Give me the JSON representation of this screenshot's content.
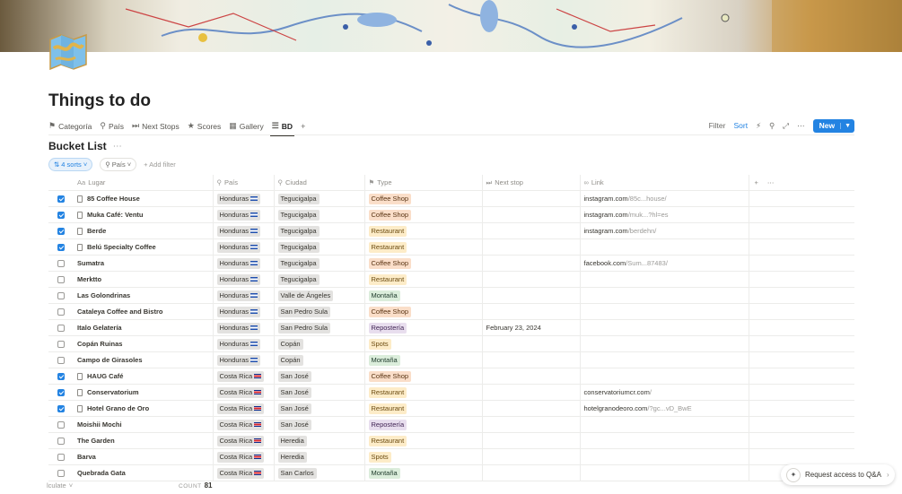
{
  "page": {
    "title": "Things to do"
  },
  "tabs": [
    {
      "label": "Categoría",
      "icon": "tag-icon"
    },
    {
      "label": "País",
      "icon": "pin-icon"
    },
    {
      "label": "Next Stops",
      "icon": "skip-forward-icon"
    },
    {
      "label": "Scores",
      "icon": "star-icon"
    },
    {
      "label": "Gallery",
      "icon": "grid-icon"
    },
    {
      "label": "BD",
      "icon": "database-icon",
      "active": true
    }
  ],
  "toolbar": {
    "filter": "Filter",
    "sort": "Sort",
    "new": "New"
  },
  "database": {
    "title": "Bucket List",
    "sorts_label": "4 sorts",
    "pais_filter": "País",
    "add_filter": "Add filter"
  },
  "columns": [
    "Lugar",
    "País",
    "Ciudad",
    "Type",
    "Next stop",
    "Link"
  ],
  "rows": [
    {
      "checked": true,
      "page": true,
      "name": "85 Coffee House",
      "country": "Honduras",
      "flag": "hn",
      "city": "Tegucigalpa",
      "type": "Coffee Shop",
      "next": "",
      "link_main": "instagram.com",
      "link_dim": "/85c...house/"
    },
    {
      "checked": true,
      "page": true,
      "name": "Muka Café: Ventu",
      "country": "Honduras",
      "flag": "hn",
      "city": "Tegucigalpa",
      "type": "Coffee Shop",
      "next": "",
      "link_main": "instagram.com",
      "link_dim": "/muk...?hl=es"
    },
    {
      "checked": true,
      "page": true,
      "name": "Berde",
      "country": "Honduras",
      "flag": "hn",
      "city": "Tegucigalpa",
      "type": "Restaurant",
      "next": "",
      "link_main": "instagram.com",
      "link_dim": "/berdehn/"
    },
    {
      "checked": true,
      "page": true,
      "name": "Belú Specialty Coffee",
      "country": "Honduras",
      "flag": "hn",
      "city": "Tegucigalpa",
      "type": "Restaurant",
      "next": "",
      "link_main": "",
      "link_dim": ""
    },
    {
      "checked": false,
      "page": false,
      "name": "Sumatra",
      "country": "Honduras",
      "flag": "hn",
      "city": "Tegucigalpa",
      "type": "Coffee Shop",
      "next": "",
      "link_main": "facebook.com",
      "link_dim": "/Sum...87483/"
    },
    {
      "checked": false,
      "page": false,
      "name": "Merktto",
      "country": "Honduras",
      "flag": "hn",
      "city": "Tegucigalpa",
      "type": "Restaurant",
      "next": "",
      "link_main": "",
      "link_dim": ""
    },
    {
      "checked": false,
      "page": false,
      "name": "Las Golondrinas",
      "country": "Honduras",
      "flag": "hn",
      "city": "Valle de Ángeles",
      "type": "Montaña",
      "next": "",
      "link_main": "",
      "link_dim": ""
    },
    {
      "checked": false,
      "page": false,
      "name": "Cataleya Coffee and Bistro",
      "country": "Honduras",
      "flag": "hn",
      "city": "San Pedro Sula",
      "type": "Coffee Shop",
      "next": "",
      "link_main": "",
      "link_dim": ""
    },
    {
      "checked": false,
      "page": false,
      "name": "Italo Gelatería",
      "country": "Honduras",
      "flag": "hn",
      "city": "San Pedro Sula",
      "type": "Repostería",
      "next": "February 23, 2024",
      "link_main": "",
      "link_dim": ""
    },
    {
      "checked": false,
      "page": false,
      "name": "Copán Ruinas",
      "country": "Honduras",
      "flag": "hn",
      "city": "Copán",
      "type": "Spots",
      "next": "",
      "link_main": "",
      "link_dim": ""
    },
    {
      "checked": false,
      "page": false,
      "name": "Campo de Girasoles",
      "country": "Honduras",
      "flag": "hn",
      "city": "Copán",
      "type": "Montaña",
      "next": "",
      "link_main": "",
      "link_dim": ""
    },
    {
      "checked": true,
      "page": true,
      "name": "HAUG Café",
      "country": "Costa Rica",
      "flag": "cr",
      "city": "San José",
      "type": "Coffee Shop",
      "next": "",
      "link_main": "",
      "link_dim": ""
    },
    {
      "checked": true,
      "page": true,
      "name": "Conservatorium",
      "country": "Costa Rica",
      "flag": "cr",
      "city": "San José",
      "type": "Restaurant",
      "next": "",
      "link_main": "conservatoriumcr.com",
      "link_dim": "/"
    },
    {
      "checked": true,
      "page": true,
      "name": "Hotel Grano de Oro",
      "country": "Costa Rica",
      "flag": "cr",
      "city": "San José",
      "type": "Restaurant",
      "next": "",
      "link_main": "hotelgranodeoro.com",
      "link_dim": "/?gc...vD_BwE"
    },
    {
      "checked": false,
      "page": false,
      "name": "Moishii Mochi",
      "country": "Costa Rica",
      "flag": "cr",
      "city": "San José",
      "type": "Repostería",
      "next": "",
      "link_main": "",
      "link_dim": ""
    },
    {
      "checked": false,
      "page": false,
      "name": "The Garden",
      "country": "Costa Rica",
      "flag": "cr",
      "city": "Heredia",
      "type": "Restaurant",
      "next": "",
      "link_main": "",
      "link_dim": ""
    },
    {
      "checked": false,
      "page": false,
      "name": "Barva",
      "country": "Costa Rica",
      "flag": "cr",
      "city": "Heredia",
      "type": "Spots",
      "next": "",
      "link_main": "",
      "link_dim": ""
    },
    {
      "checked": false,
      "page": false,
      "name": "Quebrada Gata",
      "country": "Costa Rica",
      "flag": "cr",
      "city": "San Carlos",
      "type": "Montaña",
      "next": "",
      "link_main": "",
      "link_dim": ""
    }
  ],
  "type_colors": {
    "Coffee Shop": "t-cof",
    "Restaurant": "t-rest",
    "Montaña": "t-mont",
    "Repostería": "t-rep",
    "Spots": "t-spots"
  },
  "footer": {
    "calc_label": "lculate",
    "count_label": "COUNT",
    "count_value": "81"
  },
  "qa": {
    "label": "Request access to Q&A"
  },
  "colors": {
    "accent": "#2383e2"
  }
}
